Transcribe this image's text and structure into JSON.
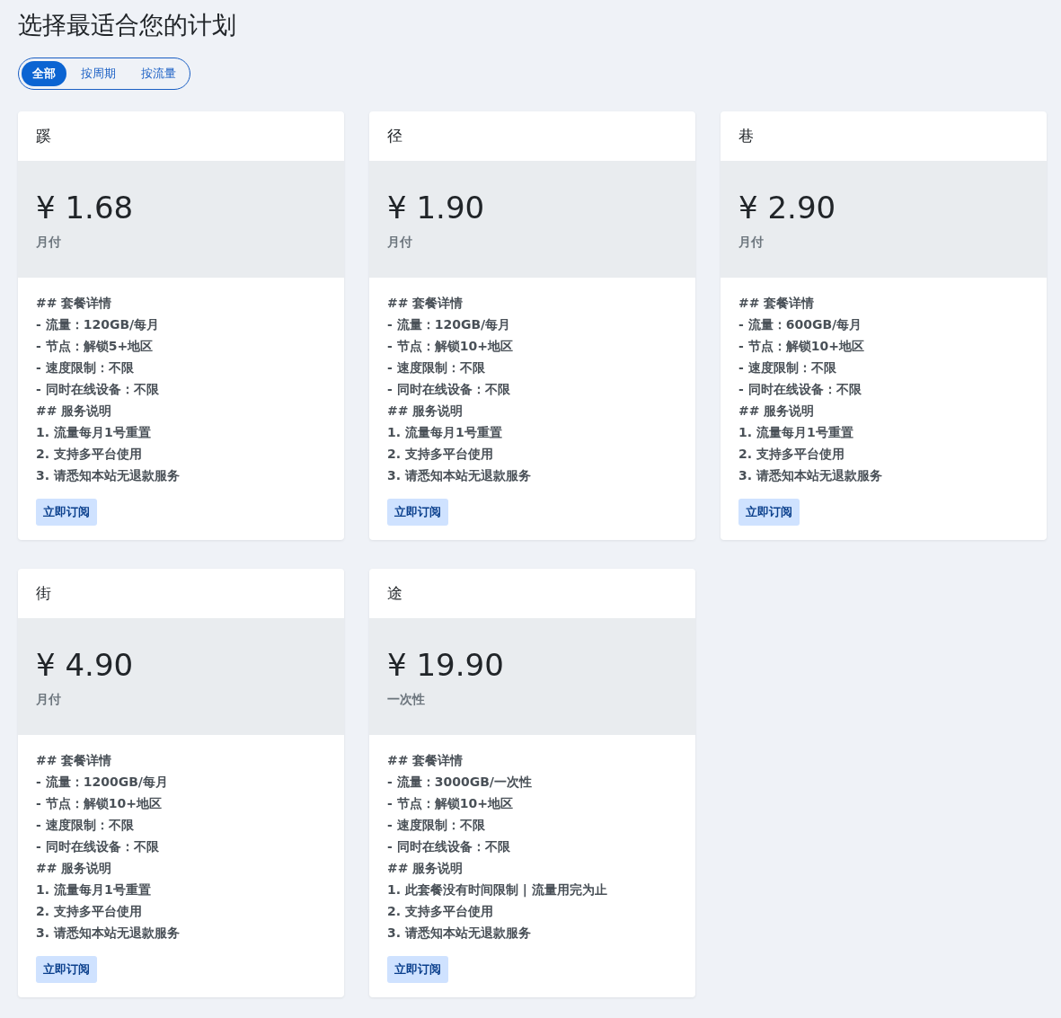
{
  "title": "选择最适合您的计划",
  "filters": [
    {
      "label": "全部",
      "selected": true
    },
    {
      "label": "按周期",
      "selected": false
    },
    {
      "label": "按流量",
      "selected": false
    }
  ],
  "plans": [
    {
      "name": "蹊",
      "price": "¥ 1.68",
      "period": "月付",
      "details": [
        "## 套餐详情",
        "- 流量：120GB/每月",
        "- 节点：解锁5+地区",
        "- 速度限制：不限",
        "- 同时在线设备：不限",
        "## 服务说明",
        "1. 流量每月1号重置",
        "2. 支持多平台使用",
        "3. 请悉知本站无退款服务"
      ],
      "button": "立即订阅"
    },
    {
      "name": "径",
      "price": "¥ 1.90",
      "period": "月付",
      "details": [
        "## 套餐详情",
        "- 流量：120GB/每月",
        "- 节点：解锁10+地区",
        "- 速度限制：不限",
        "- 同时在线设备：不限",
        "## 服务说明",
        "1. 流量每月1号重置",
        "2. 支持多平台使用",
        "3. 请悉知本站无退款服务"
      ],
      "button": "立即订阅"
    },
    {
      "name": "巷",
      "price": "¥ 2.90",
      "period": "月付",
      "details": [
        "## 套餐详情",
        "- 流量：600GB/每月",
        "- 节点：解锁10+地区",
        "- 速度限制：不限",
        "- 同时在线设备：不限",
        "## 服务说明",
        "1. 流量每月1号重置",
        "2. 支持多平台使用",
        "3. 请悉知本站无退款服务"
      ],
      "button": "立即订阅"
    },
    {
      "name": "街",
      "price": "¥ 4.90",
      "period": "月付",
      "details": [
        "## 套餐详情",
        "- 流量：1200GB/每月",
        "- 节点：解锁10+地区",
        "- 速度限制：不限",
        "- 同时在线设备：不限",
        "## 服务说明",
        "1. 流量每月1号重置",
        "2. 支持多平台使用",
        "3. 请悉知本站无退款服务"
      ],
      "button": "立即订阅"
    },
    {
      "name": "途",
      "price": "¥ 19.90",
      "period": "一次性",
      "details": [
        "## 套餐详情",
        "- 流量：3000GB/一次性",
        "- 节点：解锁10+地区",
        "- 速度限制：不限",
        "- 同时在线设备：不限",
        "## 服务说明",
        "1. 此套餐没有时间限制 | 流量用完为止",
        "2. 支持多平台使用",
        "3. 请悉知本站无退款服务"
      ],
      "button": "立即订阅"
    }
  ]
}
